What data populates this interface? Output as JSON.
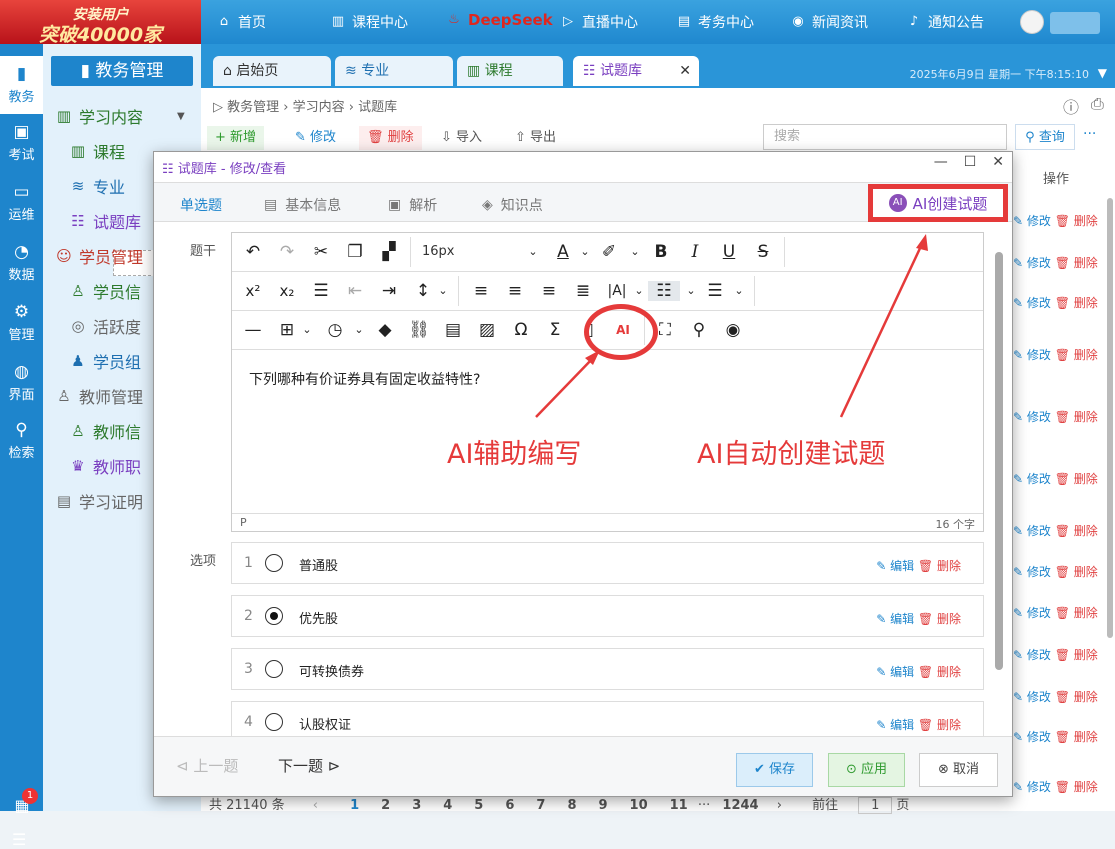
{
  "promo": {
    "line1": "安装用户",
    "line2": "突破40000家"
  },
  "topnav": {
    "home": "首页",
    "courses": "课程中心",
    "deepseek": "DeepSeek",
    "live": "直播中心",
    "exam": "考务中心",
    "news": "新闻资讯",
    "notice": "通知公告"
  },
  "rail": {
    "items": [
      "教务",
      "考试",
      "运维",
      "数据",
      "管理",
      "界面",
      "检索"
    ],
    "badge": "1"
  },
  "sidebar": {
    "header": "教务管理",
    "learning": "学习内容",
    "course": "课程",
    "major": "专业",
    "question_bank": "试题库",
    "student_mgmt": "学员管理",
    "student_info": "学员信",
    "activity": "活跃度",
    "student_group": "学员组",
    "teacher_mgmt": "教师管理",
    "teacher_info": "教师信",
    "teacher_title": "教师职",
    "certificate": "学习证明"
  },
  "tabs": {
    "start": "启始页",
    "major": "专业",
    "course": "课程",
    "bank": "试题库",
    "datetime": "2025年6月9日 星期一 下午8:15:10"
  },
  "breadcrumb": "管理 › 学习内容 › 试题库",
  "breadcrumb_root": "教务",
  "toolbar": {
    "add": "+ 新增",
    "edit": "修改",
    "delete": "删除",
    "import": "导入",
    "export": "导出",
    "search_placeholder": "搜索",
    "query": "查询"
  },
  "table": {
    "op_header": "操作",
    "edit": "修改",
    "delete": "删除"
  },
  "pager": {
    "total": "共 21140 条",
    "pages": [
      "1",
      "2",
      "3",
      "4",
      "5",
      "6",
      "7",
      "8",
      "9",
      "10",
      "11"
    ],
    "last": "1244",
    "goto": "前往",
    "page_input": "1",
    "page_unit": "页"
  },
  "dialog": {
    "title": "试题库 - 修改/查看",
    "tabs": [
      "单选题",
      "基本信息",
      "解析",
      "知识点"
    ],
    "ai_create": "AI创建试题",
    "stem_label": "题干",
    "options_label": "选项",
    "font_size": "16px",
    "stem_text": "下列哪种有价证券具有固定收益特性?",
    "status_tag": "P",
    "char_count": "16 个字",
    "options": [
      {
        "num": "1",
        "text": "普通股",
        "selected": false
      },
      {
        "num": "2",
        "text": "优先股",
        "selected": true
      },
      {
        "num": "3",
        "text": "可转换债券",
        "selected": false
      },
      {
        "num": "4",
        "text": "认股权证",
        "selected": false
      }
    ],
    "opt_edit": "编辑",
    "opt_delete": "删除",
    "prev": "上一题",
    "next": "下一题",
    "save": "保存",
    "apply": "应用",
    "cancel": "取消"
  },
  "annotations": {
    "ai_assist": "AI辅助编写",
    "ai_auto": "AI自动创建试题"
  },
  "colors": {
    "brand_blue": "#1e85cc",
    "annotation_red": "#e53a3a",
    "accent_purple": "#7a3fc0"
  }
}
